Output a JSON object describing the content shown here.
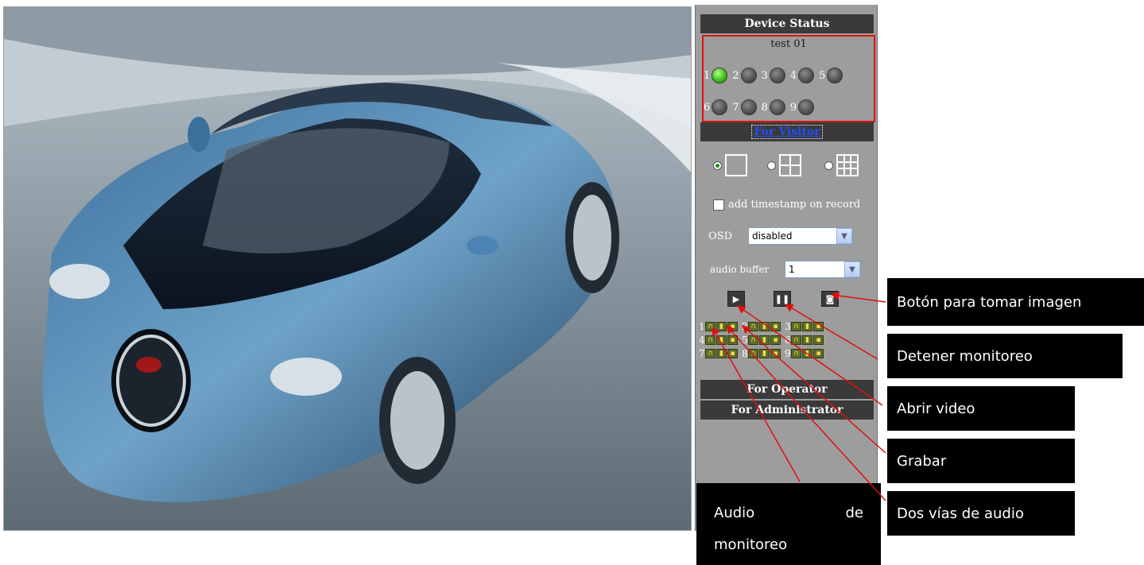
{
  "panel": {
    "device_status_header": "Device Status",
    "device_name": "test 01",
    "leds_row1": [
      {
        "num": "1",
        "on": true
      },
      {
        "num": "2",
        "on": false
      },
      {
        "num": "3",
        "on": false
      },
      {
        "num": "4",
        "on": false
      },
      {
        "num": "5",
        "on": false
      }
    ],
    "leds_row2": [
      {
        "num": "6",
        "on": false
      },
      {
        "num": "7",
        "on": false
      },
      {
        "num": "8",
        "on": false
      },
      {
        "num": "9",
        "on": false
      }
    ],
    "for_visitor_header": "For Visitor",
    "add_timestamp_label": "add timestamp on record",
    "osd_label": "OSD",
    "osd_value": "disabled",
    "audio_buffer_label": "audio buffer",
    "audio_buffer_value": "1",
    "play_icon": "play-icon",
    "pause_icon": "pause-icon",
    "snapshot_icon": "camera-icon",
    "channels": [
      [
        "1",
        "2",
        "3"
      ],
      [
        "4",
        "5",
        "6"
      ],
      [
        "7",
        "8",
        "9"
      ]
    ],
    "for_operator_header": "For Operator",
    "for_administrator_header": "For Administrator"
  },
  "callouts": {
    "snapshot": "Botón para tomar imagen",
    "stop": "Detener monitoreo",
    "open_video": "Abrir video",
    "record": "Grabar",
    "two_way_audio": "Dos vías de audio",
    "monitor_audio_1": "Audio",
    "monitor_audio_2": "de",
    "monitor_audio_3": "monitoreo"
  },
  "colors": {
    "panel_bg": "#9d9d9d",
    "header_bg": "#3a3a3a",
    "annotation_red": "#e01010",
    "led_on": "#3bbf1a"
  }
}
